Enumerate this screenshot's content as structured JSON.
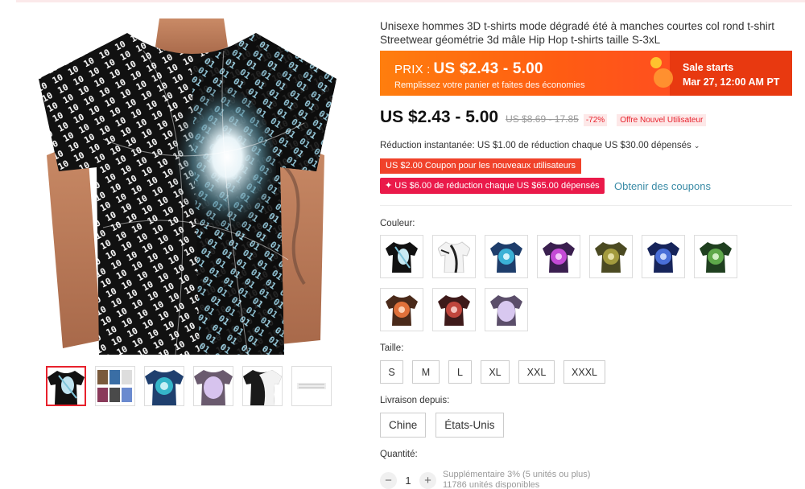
{
  "product": {
    "title": "Unisexe hommes 3D t-shirts mode dégradé été à manches courtes col rond t-shirt Streetwear géométrie 3d mâle Hip Hop t-shirts taille S-3xL"
  },
  "promo": {
    "price_label": "PRIX :",
    "price_range": "US $2.43 - 5.00",
    "subtitle": "Remplissez votre panier et faites des économies",
    "sale_line1": "Sale starts",
    "sale_line2": "Mar 27, 12:00 AM PT"
  },
  "price": {
    "current": "US $2.43 - 5.00",
    "original": "US $8.69 - 17.85",
    "discount": "-72%",
    "new_user_badge": "Offre Nouvel Utilisateur"
  },
  "reduction": {
    "text": "Réduction instantanée: US $1.00 de réduction chaque US $30.00 dépensés",
    "chevron": "⌄"
  },
  "coupons": {
    "new_user": "US $2.00 Coupon pour les nouveaux utilisateurs",
    "store": "✦ US $6.00 de réduction chaque US $65.00 dépensés",
    "get_link": "Obtenir des coupons"
  },
  "color": {
    "label": "Couleur:",
    "swatches": [
      "swirl-black-cyan",
      "swirl-white",
      "swirl-blue",
      "swirl-purple",
      "swirl-olive",
      "swirl-blue-dark",
      "swirl-green",
      "swirl-orange",
      "swirl-red",
      "swirl-lavender"
    ]
  },
  "size": {
    "label": "Taille:",
    "options": [
      "S",
      "M",
      "L",
      "XL",
      "XXL",
      "XXXL"
    ]
  },
  "shipping": {
    "label": "Livraison depuis:",
    "options": [
      "Chine",
      "États-Unis"
    ]
  },
  "quantity": {
    "label": "Quantité:",
    "value": "1",
    "minus": "−",
    "plus": "+",
    "extra": "Supplémentaire 3% (5 unités ou plus)",
    "stock": "11786 unités disponibles"
  },
  "colors": {
    "accent": "#e8212c",
    "promo_orange": "#ff6a10",
    "promo_red": "#e83910",
    "link": "#3a8ba6"
  }
}
